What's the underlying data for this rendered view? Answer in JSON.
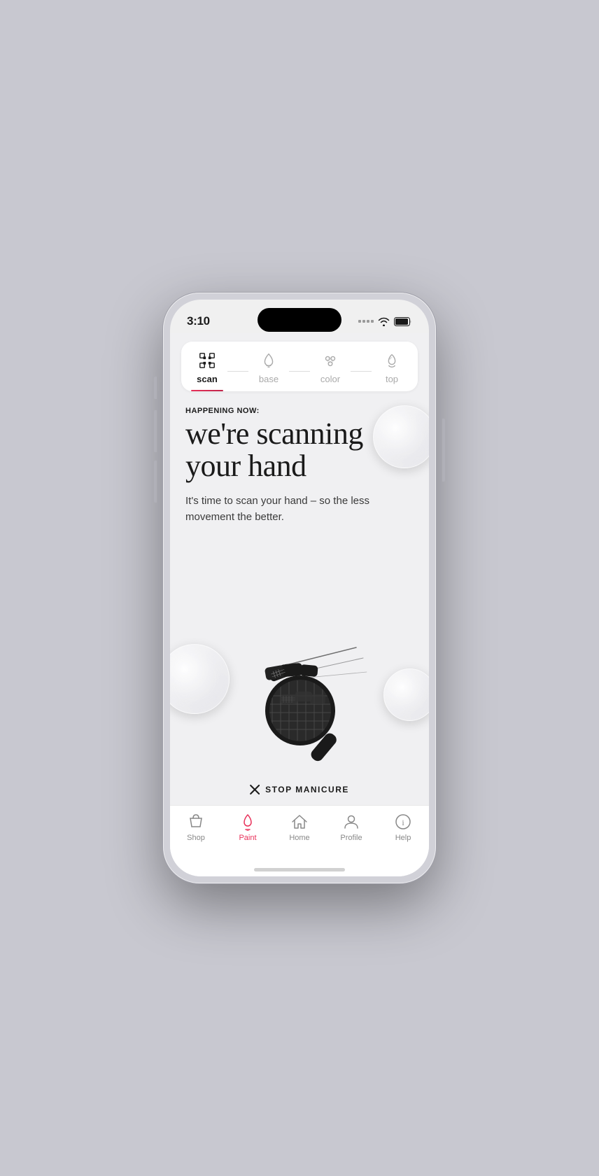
{
  "phone": {
    "status_bar": {
      "time": "3:10",
      "signal_label": "signal",
      "wifi_label": "wifi",
      "battery_label": "battery"
    },
    "step_tabs": {
      "steps": [
        {
          "id": "scan",
          "label": "scan",
          "active": true
        },
        {
          "id": "base",
          "label": "base",
          "active": false
        },
        {
          "id": "color",
          "label": "color",
          "active": false
        },
        {
          "id": "top",
          "label": "top",
          "active": false
        }
      ]
    },
    "content": {
      "happening_now": "HAPPENING NOW:",
      "headline": "we're scanning your hand",
      "subtext": "It's time to scan your hand – so the less movement the better."
    },
    "stop_button": {
      "label": "STOP MANICURE"
    },
    "bottom_nav": {
      "items": [
        {
          "id": "shop",
          "label": "Shop",
          "active": false
        },
        {
          "id": "paint",
          "label": "Paint",
          "active": true
        },
        {
          "id": "home",
          "label": "Home",
          "active": false
        },
        {
          "id": "profile",
          "label": "Profile",
          "active": false
        },
        {
          "id": "help",
          "label": "Help",
          "active": false
        }
      ]
    },
    "colors": {
      "accent": "#e8315a",
      "active_nav": "#e8315a",
      "text_primary": "#1a1a1a",
      "text_secondary": "#aaaaaa"
    }
  }
}
